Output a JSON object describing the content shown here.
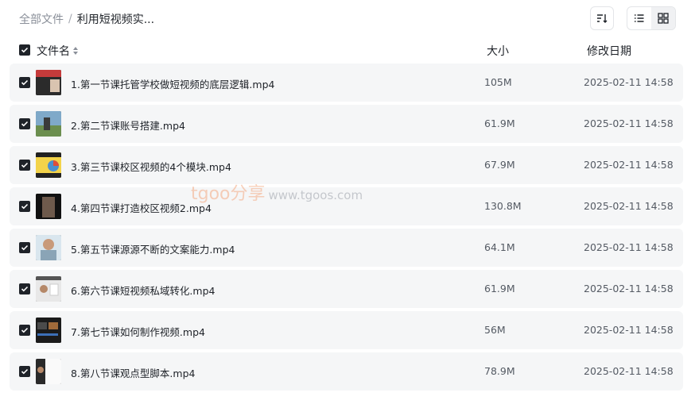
{
  "breadcrumb": {
    "root": "全部文件",
    "separator": "/",
    "current": "利用短视频实..."
  },
  "toolbar": {
    "sort_icon": "sort-icon",
    "list_icon": "list-view-icon",
    "grid_icon": "grid-view-icon"
  },
  "header": {
    "name": "文件名",
    "size": "大小",
    "date": "修改日期"
  },
  "files": [
    {
      "name": "1.第一节课托管学校做短视频的底层逻辑.mp4",
      "size": "105M",
      "date": "2025-02-11 14:58"
    },
    {
      "name": "2.第二节课账号搭建.mp4",
      "size": "61.9M",
      "date": "2025-02-11 14:58"
    },
    {
      "name": "3.第三节课校区视频的4个模块.mp4",
      "size": "67.9M",
      "date": "2025-02-11 14:58"
    },
    {
      "name": "4.第四节课打造校区视频2.mp4",
      "size": "130.8M",
      "date": "2025-02-11 14:58"
    },
    {
      "name": "5.第五节课源源不断的文案能力.mp4",
      "size": "64.1M",
      "date": "2025-02-11 14:58"
    },
    {
      "name": "6.第六节课短视频私域转化.mp4",
      "size": "61.9M",
      "date": "2025-02-11 14:58"
    },
    {
      "name": "7.第七节课如何制作视频.mp4",
      "size": "56M",
      "date": "2025-02-11 14:58"
    },
    {
      "name": "8.第八节课观点型脚本.mp4",
      "size": "78.9M",
      "date": "2025-02-11 14:58"
    }
  ],
  "watermark": {
    "brand": "tgoo分享",
    "url": "www.tgoos.com"
  }
}
